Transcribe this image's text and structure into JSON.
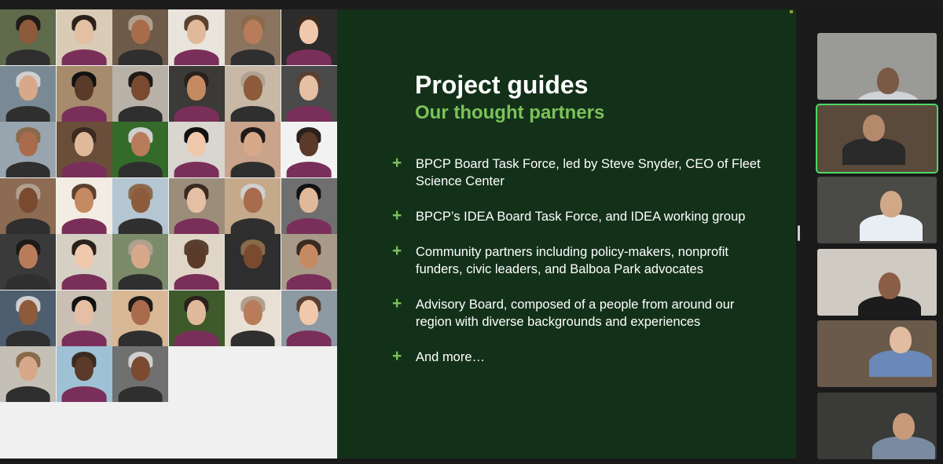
{
  "slide": {
    "title": "Project guides",
    "subtitle": "Our thought partners",
    "bullets": [
      {
        "icon": "+",
        "text": "BPCP Board Task Force, led by Steve Snyder, CEO of Fleet Science Center"
      },
      {
        "icon": "+",
        "text": "BPCP’s IDEA Board Task Force, and IDEA working group"
      },
      {
        "icon": "+",
        "text": "Community partners including policy-makers, nonprofit funders, civic leaders, and Balboa Park advocates"
      },
      {
        "icon": "+",
        "text": "Advisory Board, composed of a people from around our region with diverse backgrounds and experiences"
      },
      {
        "icon": "+",
        "text": "And more…"
      }
    ],
    "colors": {
      "panel": "#133119",
      "accent": "#7cc25a",
      "text": "#ffffff"
    }
  },
  "photo_grid": {
    "rows": 7,
    "columns": 6,
    "photo_count": 39,
    "icon": "person-photo"
  },
  "gallery": {
    "participant_count": 6,
    "active_index": 1,
    "active_color": "#4cd964"
  }
}
